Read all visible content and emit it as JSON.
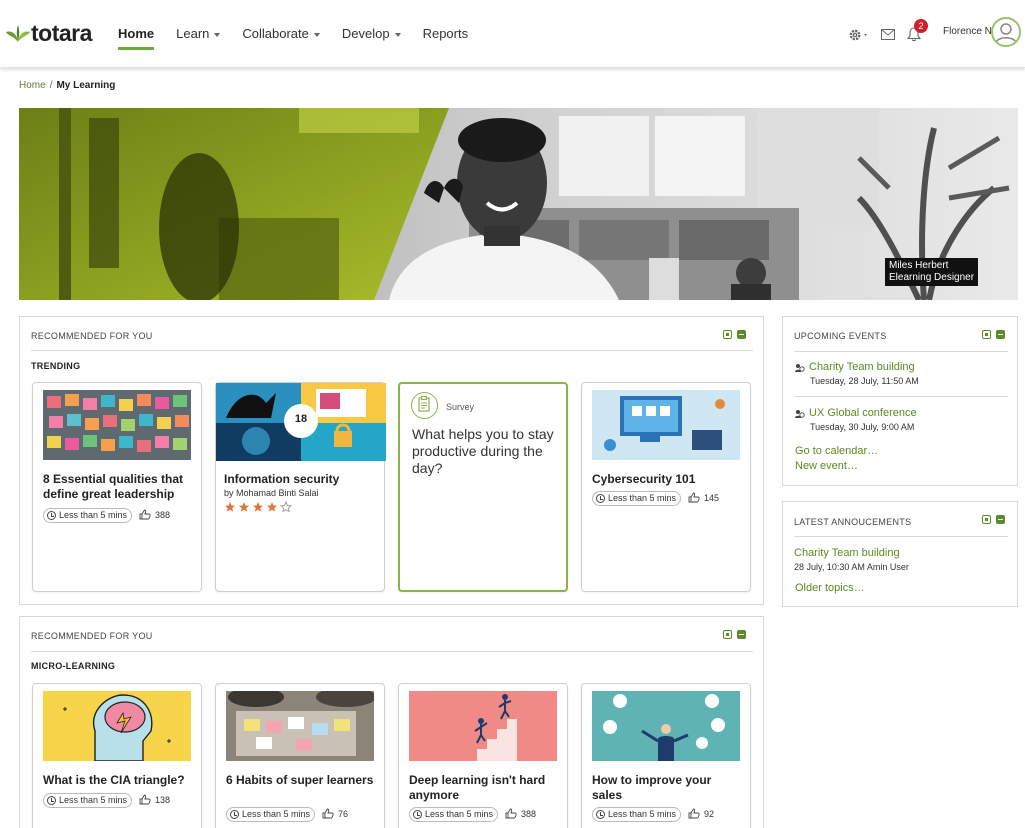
{
  "header": {
    "logo_text": "totara",
    "nav": [
      {
        "label": "Home",
        "active": true,
        "caret": false
      },
      {
        "label": "Learn",
        "active": false,
        "caret": true
      },
      {
        "label": "Collaborate",
        "active": false,
        "caret": true
      },
      {
        "label": "Develop",
        "active": false,
        "caret": true
      },
      {
        "label": "Reports",
        "active": false,
        "caret": false
      }
    ],
    "notifications_count": "2",
    "user_name": "Florence N",
    "icons": [
      "gear-icon",
      "mail-icon",
      "bell-icon"
    ],
    "accent_color": "#69ac34"
  },
  "breadcrumb": {
    "home": "Home",
    "separator": "/",
    "current": "My Learning"
  },
  "hero": {
    "caption_name": "Miles Herbert",
    "caption_role": "Elearning Designer"
  },
  "block1": {
    "title": "RECOMMENDED FOR YOU",
    "subtitle": "TRENDING",
    "cards": [
      {
        "title": "8 Essential qualities that define great leadership",
        "duration": "Less than 5 mins",
        "likes": "388"
      },
      {
        "title": "Information security",
        "author": "by Mohamad Binti Salai",
        "count_badge": "18",
        "rating": 4,
        "rating_max": 5
      },
      {
        "type": "Survey",
        "question": "What helps you to stay productive during the day?"
      },
      {
        "title": "Cybersecurity 101",
        "duration": "Less than 5 mins",
        "likes": "145"
      }
    ]
  },
  "block2": {
    "title": "RECOMMENDED FOR YOU",
    "subtitle": "MICRO-LEARNING",
    "cards": [
      {
        "title": "What is the CIA triangle?",
        "duration": "Less than 5 mins",
        "likes": "138"
      },
      {
        "title": "6 Habits of super learners",
        "duration": "Less than 5 mins",
        "likes": "76"
      },
      {
        "title": "Deep learning isn't hard anymore",
        "duration": "Less than 5 mins",
        "likes": "388"
      },
      {
        "title": "How to improve your sales",
        "duration": "Less than 5 mins",
        "likes": "92"
      }
    ]
  },
  "events": {
    "title": "UPCOMING EVENTS",
    "items": [
      {
        "name": "Charity Team building",
        "date": "Tuesday, 28 July, 11:50 AM"
      },
      {
        "name": "UX Global conference",
        "date": "Tuesday, 30 July, 9:00 AM"
      }
    ],
    "calendar_link": "Go to calendar…",
    "new_event_link": "New event…"
  },
  "announcements": {
    "title": "LATEST ANNOUCEMENTS",
    "item_title": "Charity Team building",
    "item_meta": "28 July, 10:30 AM Amin User",
    "older_link": "Older topics…"
  }
}
